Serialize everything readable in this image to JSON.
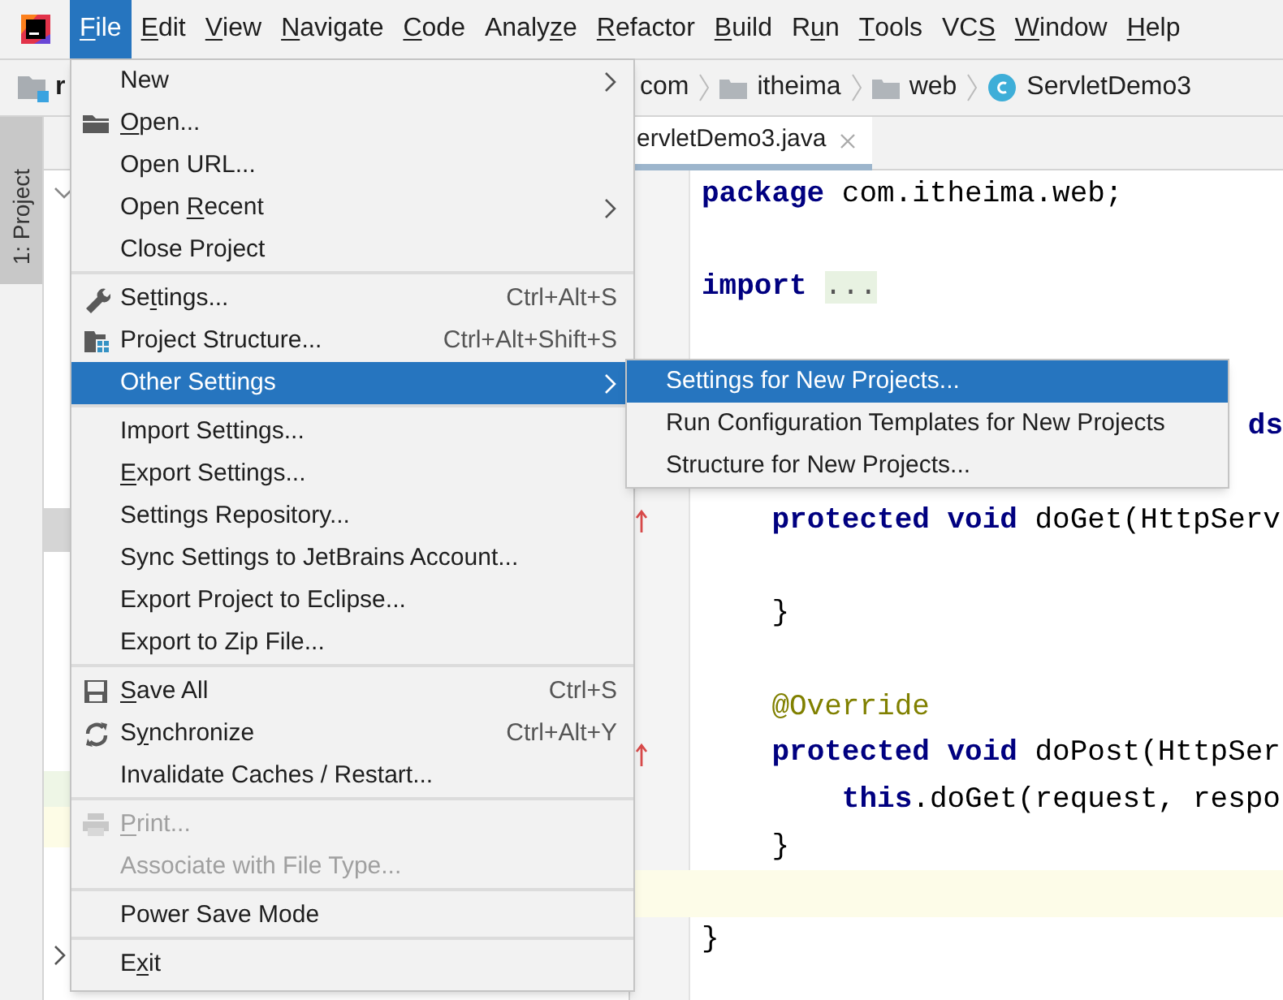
{
  "menubar": [
    {
      "key": "F",
      "post": "ile",
      "selected": true
    },
    {
      "key": "E",
      "post": "dit",
      "selected": false
    },
    {
      "key": "V",
      "post": "iew",
      "selected": false
    },
    {
      "key": "N",
      "post": "avigate",
      "selected": false
    },
    {
      "key": "C",
      "post": "ode",
      "selected": false
    },
    {
      "pre": "Analy",
      "key": "z",
      "post": "e",
      "selected": false
    },
    {
      "key": "R",
      "post": "efactor",
      "selected": false
    },
    {
      "key": "B",
      "post": "uild",
      "selected": false
    },
    {
      "pre": "R",
      "key": "u",
      "post": "n",
      "selected": false
    },
    {
      "key": "T",
      "post": "ools",
      "selected": false
    },
    {
      "pre": "VC",
      "key": "S",
      "selected": false
    },
    {
      "key": "W",
      "post": "indow",
      "selected": false
    },
    {
      "key": "H",
      "post": "elp",
      "selected": false
    }
  ],
  "breadcrumb": {
    "project": "r",
    "path": [
      {
        "label": "com",
        "kind": "package"
      },
      {
        "label": "itheima",
        "kind": "folder"
      },
      {
        "label": "web",
        "kind": "folder"
      },
      {
        "label": "ServletDemo3",
        "kind": "class"
      }
    ]
  },
  "tool_strip": {
    "tab": "1: Project",
    "selected": true
  },
  "editor_tab": {
    "label": "ervletDemo3.java",
    "selected": true
  },
  "code": [
    {
      "text": "**package** com.itheima.web;",
      "kind": "code",
      "override": false
    },
    {
      "kind": "blank",
      "override": false
    },
    {
      "text": "**import** ",
      "fold": "...",
      "kind": "code",
      "override": false
    },
    {
      "kind": "blank",
      "override": false
    },
    {
      "kind": "blank"
    },
    {
      "text": "**ds**",
      "kind": "tail"
    },
    {
      "kind": "blank"
    },
    {
      "text": "    **protected void** doGet(HttpServ",
      "kind": "code",
      "override": true
    },
    {
      "kind": "blank",
      "override": false
    },
    {
      "text": "    }",
      "kind": "code",
      "override": false
    },
    {
      "kind": "blank",
      "override": false
    },
    {
      "text": "    @Override",
      "kind": "annotation",
      "override": false
    },
    {
      "text": "    **protected void** doPost(HttpSer",
      "kind": "code",
      "override": true
    },
    {
      "text": "        **this**.doGet(request, respo",
      "kind": "code",
      "override": false
    },
    {
      "text": "    }",
      "kind": "code",
      "override": false
    },
    {
      "kind": "current",
      "override": false
    },
    {
      "text": "}",
      "kind": "code",
      "override": false
    }
  ],
  "file_menu": [
    [
      {
        "label": "New",
        "kind": "plain",
        "submenu": true,
        "selected": false,
        "disabled": false
      },
      {
        "key": "O",
        "post": "pen...",
        "kind": "folder",
        "submenu": false,
        "selected": false,
        "disabled": false
      },
      {
        "label": "Open URL...",
        "kind": "plain",
        "submenu": false,
        "selected": false,
        "disabled": false
      },
      {
        "pre": "Open ",
        "key": "R",
        "post": "ecent",
        "kind": "plain",
        "submenu": true,
        "selected": false,
        "disabled": false
      },
      {
        "label": "Close Project",
        "kind": "plain",
        "submenu": false,
        "selected": false,
        "disabled": false
      }
    ],
    [
      {
        "pre": "Se",
        "key": "t",
        "post": "tings...",
        "kind": "wrench",
        "shortcut": "Ctrl+Alt+S",
        "submenu": false,
        "selected": false,
        "disabled": false
      },
      {
        "label": "Project Structure...",
        "kind": "structure",
        "shortcut": "Ctrl+Alt+Shift+S",
        "submenu": false,
        "selected": false,
        "disabled": false
      },
      {
        "label": "Other Settings",
        "kind": "plain",
        "submenu": true,
        "selected": true,
        "disabled": false
      }
    ],
    [
      {
        "label": "Import Settings...",
        "kind": "plain",
        "submenu": false,
        "selected": false,
        "disabled": false
      },
      {
        "key": "E",
        "post": "xport Settings...",
        "kind": "plain",
        "submenu": false,
        "selected": false,
        "disabled": false
      },
      {
        "label": "Settings Repository...",
        "kind": "plain",
        "submenu": false,
        "selected": false,
        "disabled": false
      },
      {
        "label": "Sync Settings to JetBrains Account...",
        "kind": "plain",
        "submenu": false,
        "selected": false,
        "disabled": false
      },
      {
        "label": "Export Project to Eclipse...",
        "kind": "plain",
        "submenu": false,
        "selected": false,
        "disabled": false
      },
      {
        "label": "Export to Zip File...",
        "kind": "plain",
        "submenu": false,
        "selected": false,
        "disabled": false
      }
    ],
    [
      {
        "key": "S",
        "post": "ave All",
        "kind": "save",
        "shortcut": "Ctrl+S",
        "submenu": false,
        "selected": false,
        "disabled": false
      },
      {
        "pre": "S",
        "key": "y",
        "post": "nchronize",
        "kind": "sync",
        "shortcut": "Ctrl+Alt+Y",
        "submenu": false,
        "selected": false,
        "disabled": false
      },
      {
        "label": "Invalidate Caches / Restart...",
        "kind": "plain",
        "submenu": false,
        "selected": false,
        "disabled": false
      }
    ],
    [
      {
        "key": "P",
        "post": "rint...",
        "kind": "print",
        "submenu": false,
        "selected": false,
        "disabled": true
      },
      {
        "label": "Associate with File Type...",
        "kind": "plain",
        "submenu": false,
        "selected": false,
        "disabled": true
      }
    ],
    [
      {
        "label": "Power Save Mode",
        "kind": "plain",
        "submenu": false,
        "selected": false,
        "disabled": false
      }
    ],
    [
      {
        "pre": "E",
        "key": "x",
        "post": "it",
        "kind": "plain",
        "submenu": false,
        "selected": false,
        "disabled": false
      }
    ]
  ],
  "submenu": [
    {
      "label": "Settings for New Projects...",
      "selected": true
    },
    {
      "label": "Run Configuration Templates for New Projects",
      "selected": false
    },
    {
      "label": "Structure for New Projects...",
      "selected": false
    }
  ]
}
